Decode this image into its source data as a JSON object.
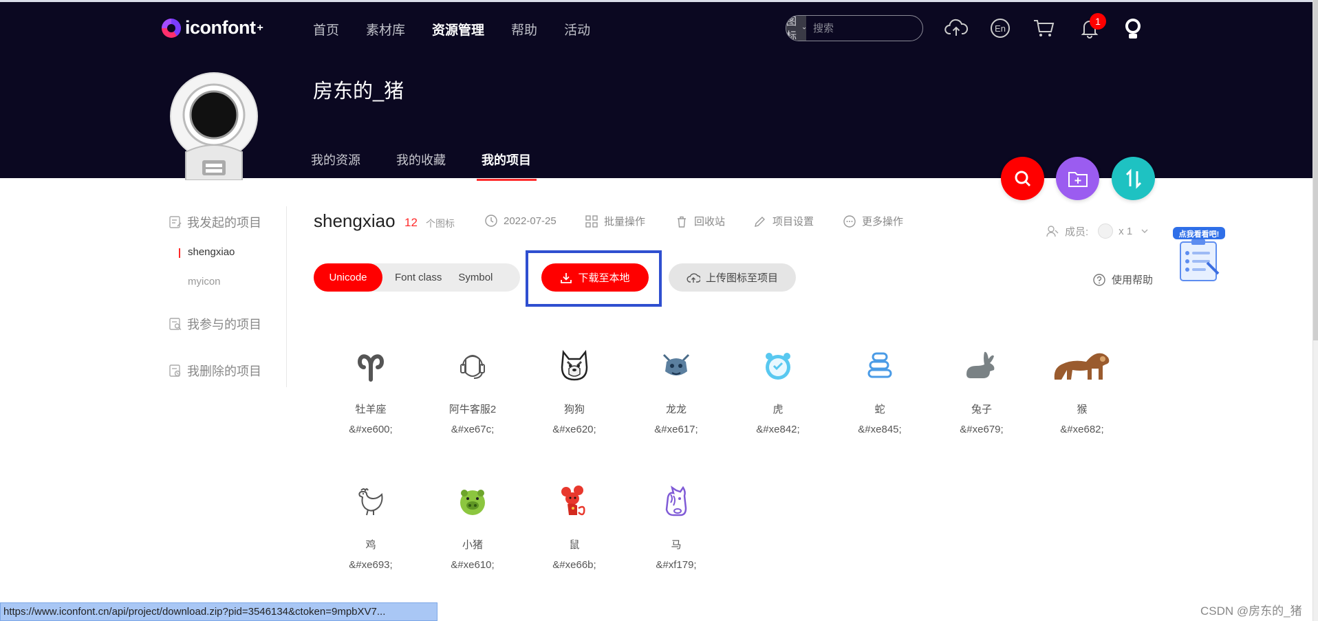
{
  "header": {
    "logo_text": "iconfont",
    "logo_sup": "+",
    "nav": [
      "首页",
      "素材库",
      "资源管理",
      "帮助",
      "活动"
    ],
    "nav_active_index": 2,
    "search": {
      "type": "图标",
      "placeholder": "搜索"
    },
    "notification_count": "1",
    "lang_icon_text": "En"
  },
  "profile": {
    "username": "房东的_猪",
    "tabs": [
      "我的资源",
      "我的收藏",
      "我的项目"
    ],
    "active_tab_index": 2
  },
  "sidebar": {
    "started_label": "我发起的项目",
    "projects": [
      "shengxiao",
      "myicon"
    ],
    "active_project_index": 0,
    "joined_label": "我参与的项目",
    "deleted_label": "我删除的项目"
  },
  "project": {
    "name": "shengxiao",
    "icon_count": "12",
    "icon_count_label": "个图标",
    "date": "2022-07-25",
    "batch_label": "批量操作",
    "recycle_label": "回收站",
    "settings_label": "项目设置",
    "more_label": "更多操作",
    "members_label": "成员:",
    "members_count": "x 1"
  },
  "toolbar": {
    "formats": [
      "Unicode",
      "Font class",
      "Symbol"
    ],
    "active_format_index": 0,
    "download_label": "下载至本地",
    "upload_label": "上传图标至项目",
    "help_label": "使用帮助",
    "promo_label": "点我看看吧!"
  },
  "icons": [
    {
      "name": "牡羊座",
      "code": "&#xe600;",
      "icon": "aries-icon"
    },
    {
      "name": "阿牛客服2",
      "code": "&#xe67c;",
      "icon": "headset-service-icon"
    },
    {
      "name": "狗狗",
      "code": "&#xe620;",
      "icon": "dog-icon"
    },
    {
      "name": "龙龙",
      "code": "&#xe617;",
      "icon": "dragon-icon"
    },
    {
      "name": "虎",
      "code": "&#xe842;",
      "icon": "tiger-clock-icon"
    },
    {
      "name": "蛇",
      "code": "&#xe845;",
      "icon": "snake-icon"
    },
    {
      "name": "兔子",
      "code": "&#xe679;",
      "icon": "rabbit-icon"
    },
    {
      "name": "猴",
      "code": "&#xe682;",
      "icon": "monkey-icon"
    },
    {
      "name": "鸡",
      "code": "&#xe693;",
      "icon": "rooster-icon"
    },
    {
      "name": "小猪",
      "code": "&#xe610;",
      "icon": "pig-icon"
    },
    {
      "name": "鼠",
      "code": "&#xe66b;",
      "icon": "mouse-icon"
    },
    {
      "name": "马",
      "code": "&#xf179;",
      "icon": "horse-icon"
    }
  ],
  "status_url": "https://www.iconfont.cn/api/project/download.zip?pid=3546134&ctoken=9mpbXV7...",
  "watermark": "CSDN @房东的_猪",
  "colors": {
    "header_bg": "#0b0821",
    "brand_red": "#ff0000",
    "fab_search": "#ff0000",
    "fab_folder": "#9b5cf0",
    "fab_sort": "#1ec2c2",
    "highlight_frame": "#2f4fd0"
  }
}
